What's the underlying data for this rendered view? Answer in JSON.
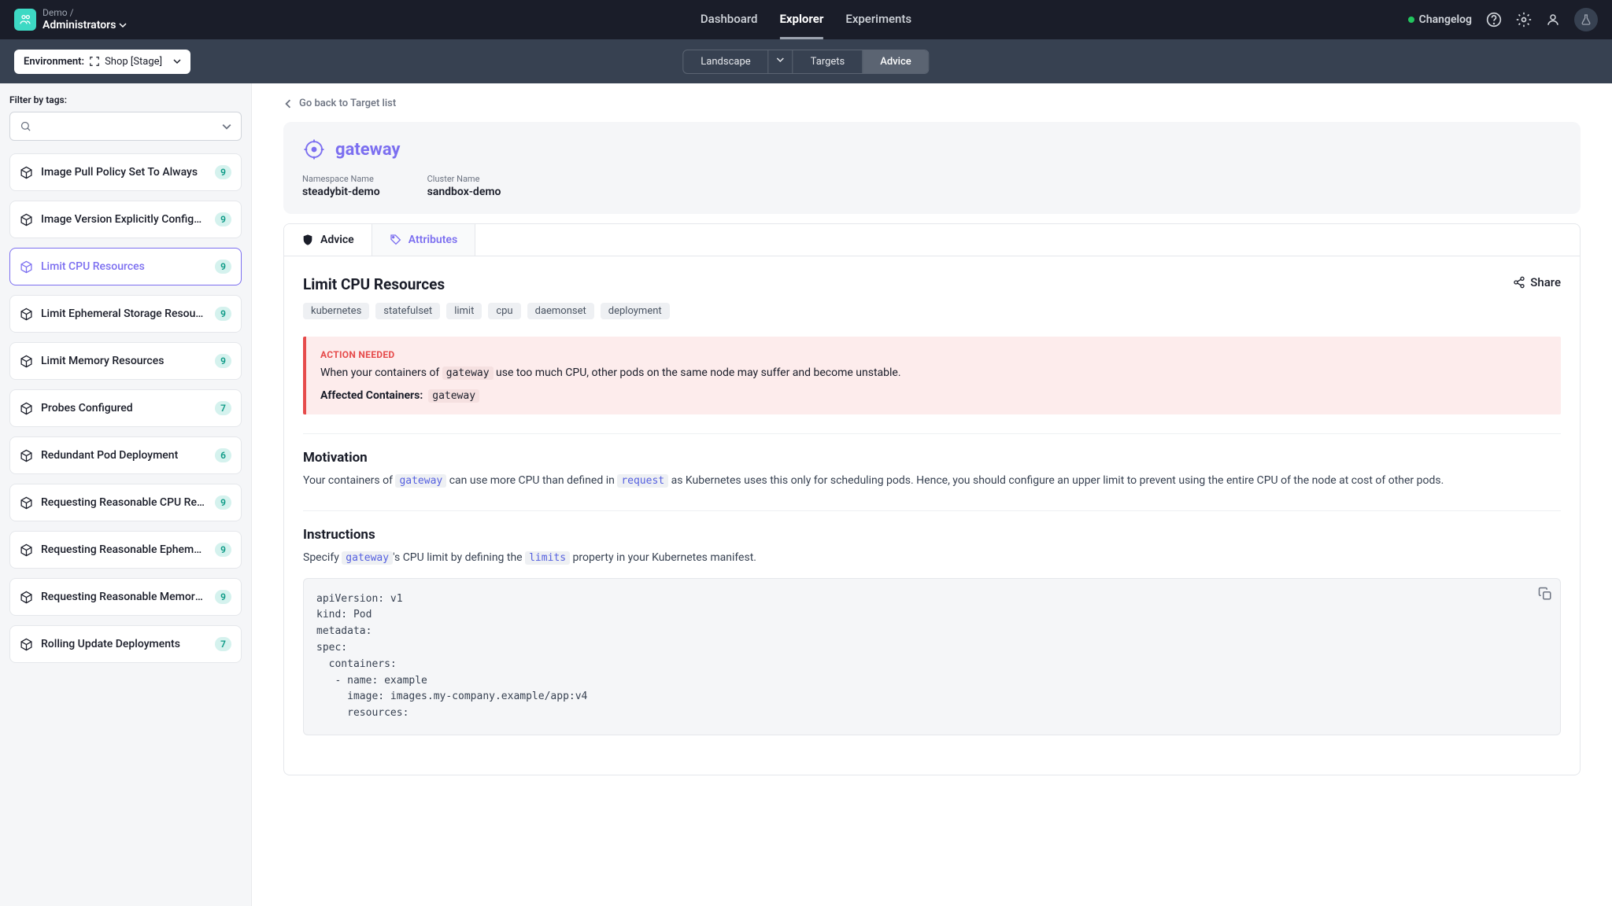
{
  "header": {
    "breadcrumb": "Demo /",
    "org": "Administrators",
    "nav": {
      "dashboard": "Dashboard",
      "explorer": "Explorer",
      "experiments": "Experiments"
    },
    "changelog": "Changelog"
  },
  "subheader": {
    "env_label": "Environment:",
    "env_value": "Shop [Stage]",
    "segments": {
      "landscape": "Landscape",
      "targets": "Targets",
      "advice": "Advice"
    }
  },
  "sidebar": {
    "filter_label": "Filter by tags:",
    "items": [
      {
        "title": "Image Pull Policy Set To Always",
        "count": "9"
      },
      {
        "title": "Image Version Explicitly Configured",
        "count": "9"
      },
      {
        "title": "Limit CPU Resources",
        "count": "9"
      },
      {
        "title": "Limit Ephemeral Storage Resources",
        "count": "9"
      },
      {
        "title": "Limit Memory Resources",
        "count": "9"
      },
      {
        "title": "Probes Configured",
        "count": "7"
      },
      {
        "title": "Redundant Pod Deployment",
        "count": "6"
      },
      {
        "title": "Requesting Reasonable CPU Resources",
        "count": "9"
      },
      {
        "title": "Requesting Reasonable Ephemeral Stor...",
        "count": "9"
      },
      {
        "title": "Requesting Reasonable Memory Reso...",
        "count": "9"
      },
      {
        "title": "Rolling Update Deployments",
        "count": "7"
      }
    ]
  },
  "main": {
    "back": "Go back to Target list",
    "target_name": "gateway",
    "meta": {
      "namespace_label": "Namespace Name",
      "namespace_value": "steadybit-demo",
      "cluster_label": "Cluster Name",
      "cluster_value": "sandbox-demo"
    },
    "tabs": {
      "advice": "Advice",
      "attributes": "Attributes"
    },
    "panel": {
      "title": "Limit CPU Resources",
      "share": "Share",
      "tags": [
        "kubernetes",
        "statefulset",
        "limit",
        "cpu",
        "daemonset",
        "deployment"
      ]
    },
    "alert": {
      "title": "ACTION NEEDED",
      "text_pre": "When your containers of ",
      "text_code": "gateway",
      "text_post": " use too much CPU, other pods on the same node may suffer and become unstable.",
      "affected_label": "Affected Containers:",
      "affected_value": "gateway"
    },
    "motivation": {
      "heading": "Motivation",
      "pre": "Your containers of ",
      "c1": "gateway",
      "mid": " can use more CPU than defined in ",
      "c2": "request",
      "post": " as Kubernetes uses this only for scheduling pods. Hence, you should configure an upper limit to prevent using the entire CPU of the node at cost of other pods."
    },
    "instructions": {
      "heading": "Instructions",
      "pre": "Specify ",
      "c1": "gateway",
      "mid": "'s CPU limit by defining the ",
      "c2": "limits",
      "post": " property in your Kubernetes manifest."
    },
    "code": "apiVersion: v1\nkind: Pod\nmetadata:\nspec:\n  containers:\n   - name: example\n     image: images.my-company.example/app:v4\n     resources:"
  }
}
